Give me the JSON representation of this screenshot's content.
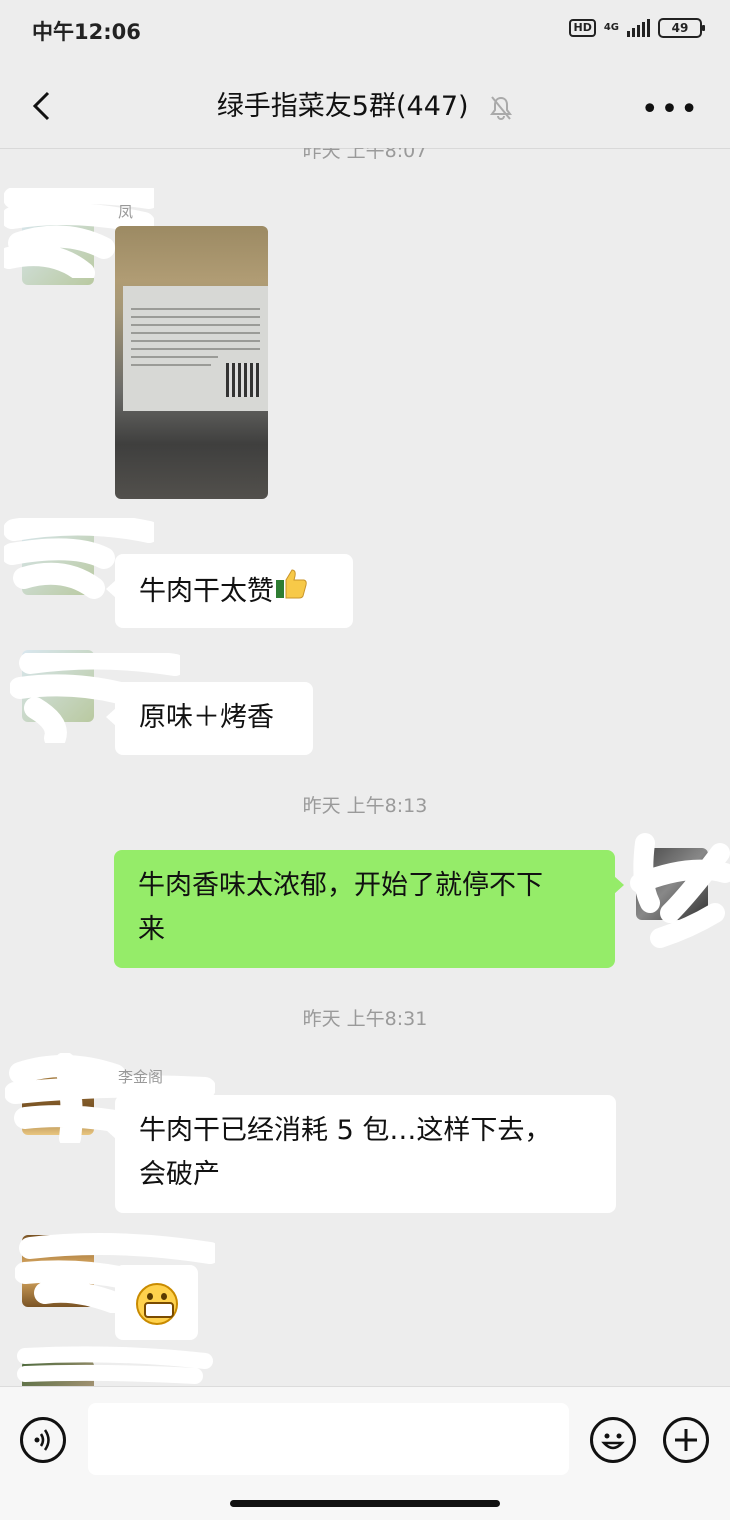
{
  "status_bar": {
    "time": "中午12:06",
    "hd": "HD",
    "network": "4G",
    "battery": "49"
  },
  "header": {
    "title": "绿手指菜友5群(447)"
  },
  "timestamps": [
    "昨天 上午8:07",
    "昨天 上午8:13",
    "昨天 上午8:31"
  ],
  "messages": [
    {
      "direction": "in",
      "nickname": "凤",
      "type": "image",
      "image_caption": "生态牛肉干"
    },
    {
      "direction": "in",
      "type": "text",
      "text": "牛肉干太赞"
    },
    {
      "direction": "in",
      "type": "text",
      "text": "原味＋烤香"
    },
    {
      "direction": "out",
      "type": "text",
      "text_line1": "牛肉香味太浓郁，开始了就停不下",
      "text_line2": "来"
    },
    {
      "direction": "in",
      "nickname": "李金阁",
      "type": "text",
      "text_line1": "牛肉干已经消耗 5 包…这样下去，",
      "text_line2": "会破产"
    },
    {
      "direction": "in",
      "type": "emoji",
      "emoji": "grin-icon"
    }
  ],
  "icons": [
    "back-icon",
    "bell-muted-icon",
    "more-icon",
    "voice-icon",
    "emoji-icon",
    "plus-icon",
    "thumbs-up-icon"
  ],
  "colors": {
    "background": "#ededed",
    "out_bubble": "#95ec69",
    "in_bubble": "#ffffff"
  }
}
